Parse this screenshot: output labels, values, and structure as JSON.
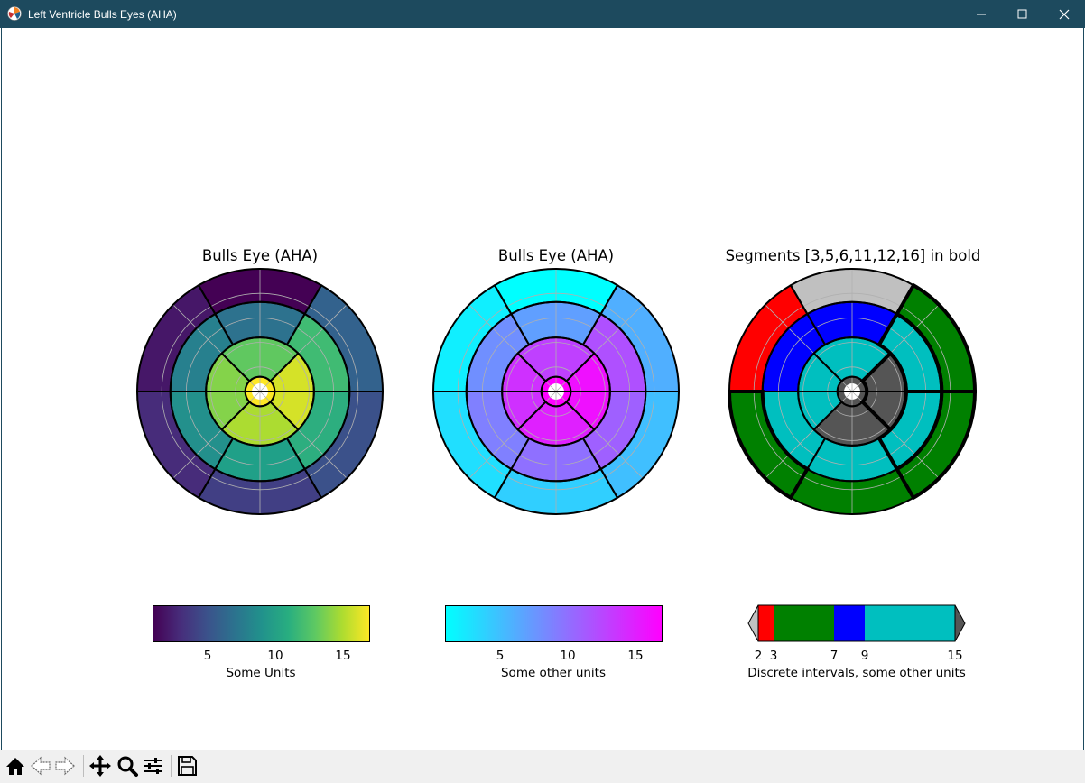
{
  "window": {
    "title": "Left Ventricle Bulls Eyes (AHA)",
    "icon": "matplotlib-icon",
    "controls": [
      "minimize-icon",
      "maximize-icon",
      "close-icon"
    ]
  },
  "chart_data": [
    {
      "type": "heatmap",
      "subtype": "polar-bullseye",
      "title": "Bulls Eye (AHA)",
      "colormap": "viridis",
      "segments": [
        1,
        2,
        3,
        4,
        5,
        6,
        7,
        8,
        9,
        10,
        11,
        12,
        13,
        14,
        15,
        16,
        17
      ],
      "values": [
        1,
        2,
        3,
        4,
        5,
        6,
        7,
        8,
        9,
        10,
        11,
        12,
        13,
        14,
        15,
        16,
        17
      ],
      "colorbar": {
        "ticks": [
          "5",
          "10",
          "15"
        ],
        "label": "Some Units",
        "range": [
          1,
          17
        ]
      }
    },
    {
      "type": "heatmap",
      "subtype": "polar-bullseye",
      "title": "Bulls Eye (AHA)",
      "colormap": "cool",
      "segments": [
        1,
        2,
        3,
        4,
        5,
        6,
        7,
        8,
        9,
        10,
        11,
        12,
        13,
        14,
        15,
        16,
        17
      ],
      "values": [
        1,
        2,
        3,
        4,
        5,
        6,
        7,
        8,
        9,
        10,
        11,
        12,
        13,
        14,
        15,
        16,
        17
      ],
      "colorbar": {
        "ticks": [
          "5",
          "10",
          "15"
        ],
        "label": "Some other units",
        "range": [
          1,
          17
        ]
      }
    },
    {
      "type": "heatmap",
      "subtype": "polar-bullseye",
      "title": "Segments [3,5,6,11,12,16] in bold",
      "colormap": "discrete",
      "segments": [
        1,
        2,
        3,
        4,
        5,
        6,
        7,
        8,
        9,
        10,
        11,
        12,
        13,
        14,
        15,
        16,
        17
      ],
      "values": [
        1,
        2,
        3,
        4,
        5,
        6,
        7,
        8,
        9,
        10,
        11,
        12,
        13,
        14,
        15,
        16,
        17
      ],
      "bold_segments": [
        3,
        5,
        6,
        11,
        12,
        16
      ],
      "colorbar": {
        "ticks": [
          "2",
          "3",
          "7",
          "9",
          "15"
        ],
        "bounds": [
          2,
          3,
          7,
          9,
          15
        ],
        "colors": [
          "#ff0000",
          "#008000",
          "#0000ff",
          "#00bfbf"
        ],
        "under_color": "#c0c0c0",
        "over_color": "#555555",
        "extend": "both",
        "label": "Discrete intervals, some other units"
      }
    }
  ],
  "toolbar": {
    "buttons": [
      {
        "icon": "home-icon"
      },
      {
        "icon": "back-icon"
      },
      {
        "icon": "forward-icon"
      },
      {
        "icon": "pan-icon"
      },
      {
        "icon": "zoom-icon"
      },
      {
        "icon": "configure-subplots-icon"
      },
      {
        "icon": "save-icon"
      }
    ]
  }
}
